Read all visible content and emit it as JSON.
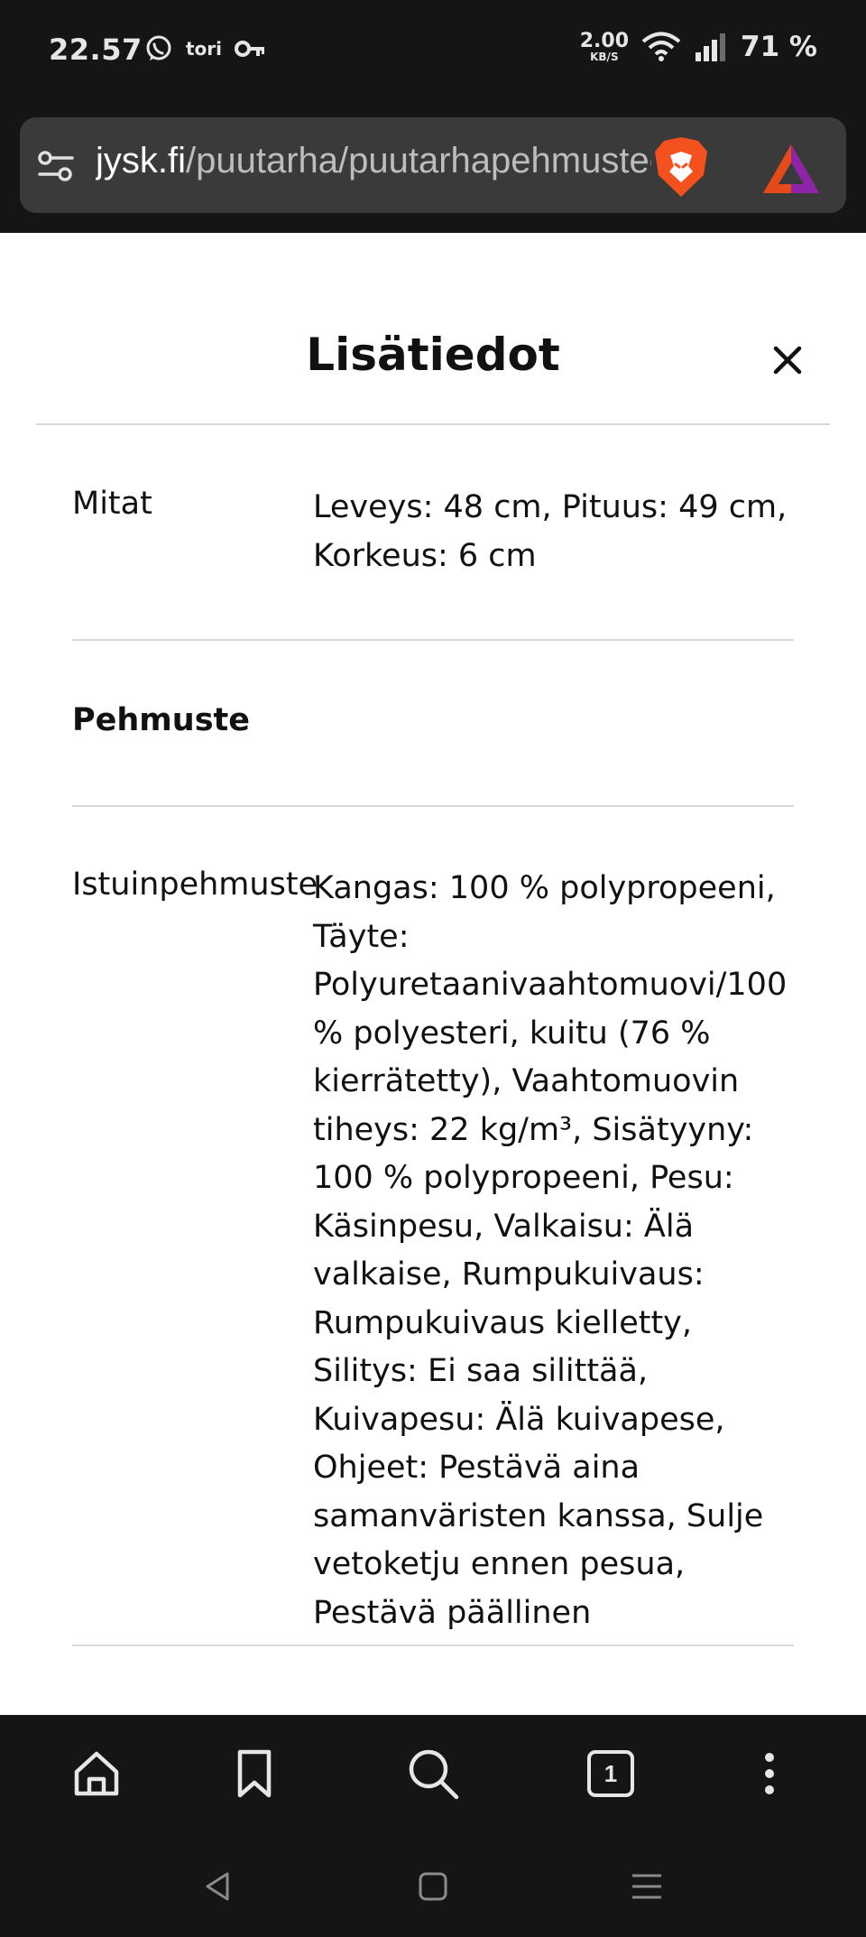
{
  "status_bar": {
    "time": "22.57",
    "notification_icons": [
      "whatsapp-icon",
      "key-icon"
    ],
    "tori_label": "tori",
    "net_speed_value": "2.00",
    "net_speed_unit": "KB/S",
    "battery": "71 %"
  },
  "browser": {
    "url_host": "jysk.fi",
    "url_path": "/puutarha/puutarhapehmusteet",
    "icons": [
      "site-settings-icon",
      "brave-shields-icon",
      "brave-rewards-icon"
    ]
  },
  "modal": {
    "title": "Lisätiedot",
    "close_icon": "close-icon",
    "rows": [
      {
        "label": "Mitat",
        "value": "Leveys: 48 cm, Pituus: 49 cm, Korkeus: 6 cm"
      },
      {
        "section": "Pehmuste"
      },
      {
        "label": "Istuinpehmuste",
        "value": "Kangas: 100 % polypropeeni, Täyte: Polyuretaanivaahtomuovi/100 % polyesteri, kuitu (76 % kierrätetty), Vaahtomuovin tiheys: 22 kg/m³, Sisätyyny: 100 % polypropeeni, Pesu: Käsinpesu, Valkaisu: Älä valkaise, Rumpukuivaus: Rumpukuivaus kielletty, Silitys: Ei saa silittää, Kuivapesu: Älä kuivapese, Ohjeet: Pestävä aina samanväristen kanssa, Sulje vetoketju ennen pesua, Pestävä päällinen"
      }
    ]
  },
  "toolbar": {
    "tab_count": "1",
    "icons": [
      "home-icon",
      "bookmark-icon",
      "search-icon",
      "tabs-icon",
      "more-icon"
    ]
  },
  "nav_bar": {
    "icons": [
      "back-icon",
      "home-square-icon",
      "recents-icon"
    ]
  }
}
